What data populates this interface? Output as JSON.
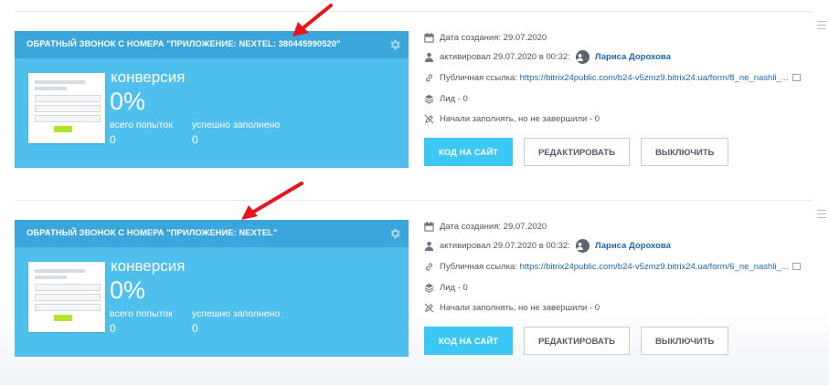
{
  "colors": {
    "card": "#4fc0ee",
    "card_head": "#3aa6db",
    "primary_button": "#3bc8f5",
    "link": "#2067b0",
    "arrow": "#e8151b"
  },
  "forms": [
    {
      "title": "ОБРАТНЫЙ ЗВОНОК С НОМЕРА \"ПРИЛОЖЕНИЕ: NEXTEL: 380445990520\"",
      "conversion_label": "конверсия",
      "conversion_value": "0%",
      "attempts_label": "всего попыток",
      "attempts_value": "0",
      "filled_label": "успешно заполнено",
      "filled_value": "0",
      "created_label": "Дата создания:",
      "created_value": "29.07.2020",
      "activated_label": "активировал 29.07.2020 в 00:32:",
      "user_name": "Лариса Дорохова",
      "public_link_label": "Публичная ссылка:",
      "public_link": "https://bitrix24public.com/b24-v5zmz9.bitrix24.ua/form/8_ne_nashli_...",
      "leads": "Лид - 0",
      "started": "Начали заполнять, но не завершили - 0",
      "btn_code": "КОД НА САЙТ",
      "btn_edit": "РЕДАКТИРОВАТЬ",
      "btn_disable": "ВЫКЛЮЧИТЬ"
    },
    {
      "title": "ОБРАТНЫЙ ЗВОНОК С НОМЕРА \"ПРИЛОЖЕНИЕ: NEXTEL\"",
      "conversion_label": "конверсия",
      "conversion_value": "0%",
      "attempts_label": "всего попыток",
      "attempts_value": "0",
      "filled_label": "успешно заполнено",
      "filled_value": "0",
      "created_label": "Дата создания:",
      "created_value": "29.07.2020",
      "activated_label": "активировал 29.07.2020 в 00:32:",
      "user_name": "Лариса Дорохова",
      "public_link_label": "Публичная ссылка:",
      "public_link": "https://bitrix24public.com/b24-v5zmz9.bitrix24.ua/form/6_ne_nashli_...",
      "leads": "Лид - 0",
      "started": "Начали заполнять, но не завершили - 0",
      "btn_code": "КОД НА САЙТ",
      "btn_edit": "РЕДАКТИРОВАТЬ",
      "btn_disable": "ВЫКЛЮЧИТЬ"
    }
  ],
  "icons": [
    "gear-icon",
    "calendar-icon",
    "user-icon",
    "link-icon",
    "layers-icon",
    "pencil-off-icon",
    "menu-icon",
    "external-link-icon",
    "arrow-annotation"
  ]
}
